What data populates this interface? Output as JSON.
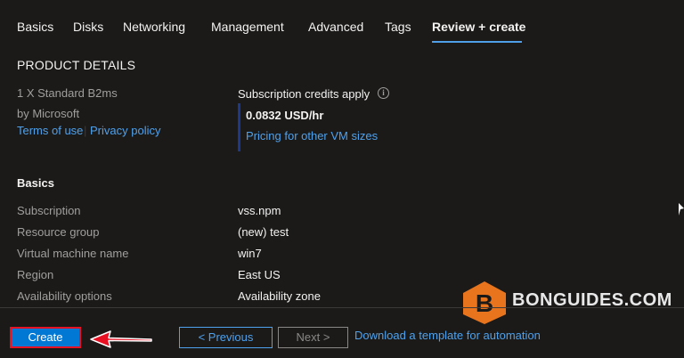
{
  "tabs": [
    {
      "label": "Basics"
    },
    {
      "label": "Disks"
    },
    {
      "label": "Networking"
    },
    {
      "label": "Management"
    },
    {
      "label": "Advanced"
    },
    {
      "label": "Tags"
    },
    {
      "label": "Review + create",
      "active": true
    }
  ],
  "product": {
    "heading": "PRODUCT DETAILS",
    "name": "1 X Standard B2ms",
    "publisher": "by Microsoft",
    "terms_link": "Terms of use",
    "separator": "|",
    "privacy_link": "Privacy policy",
    "credits_label": "Subscription credits apply",
    "price": "0.0832 USD/hr",
    "pricing_link": "Pricing for other VM sizes"
  },
  "basics": {
    "heading": "Basics",
    "rows": [
      {
        "label": "Subscription",
        "value": "vss.npm"
      },
      {
        "label": "Resource group",
        "value": "(new) test"
      },
      {
        "label": "Virtual machine name",
        "value": "win7"
      },
      {
        "label": "Region",
        "value": "East US"
      },
      {
        "label": "Availability options",
        "value": "Availability zone"
      }
    ]
  },
  "footer": {
    "create_label": "Create",
    "previous_label": "< Previous",
    "next_label": "Next >",
    "download_link": "Download a template for automation"
  },
  "watermark": {
    "text": "BONGUIDES.COM",
    "letter": "B"
  },
  "colors": {
    "background": "#1b1a19",
    "accent": "#0078d4",
    "link": "#4ea1ec",
    "highlight_border": "#e81123",
    "watermark_orange": "#e8741e"
  }
}
